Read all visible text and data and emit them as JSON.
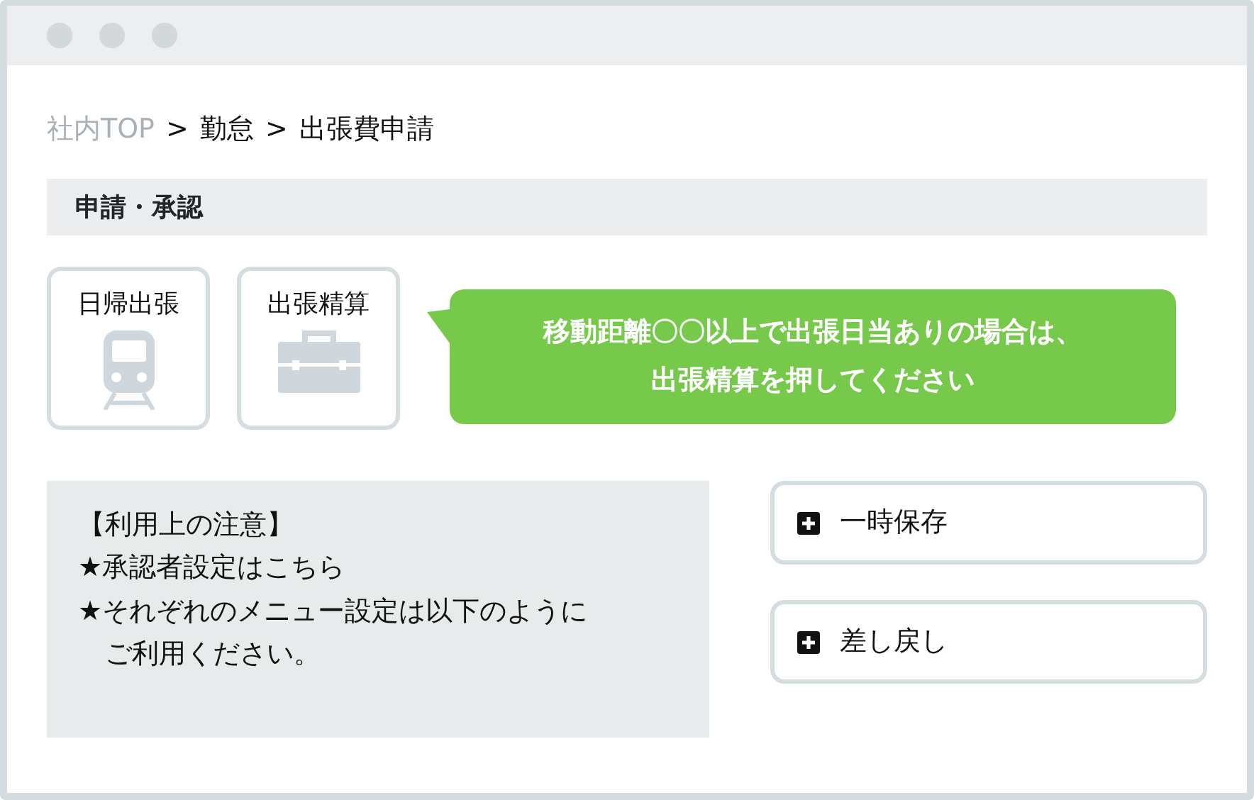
{
  "breadcrumb": [
    {
      "kind": "muted",
      "label": "社内TOP"
    },
    {
      "kind": "separator",
      "label": ">"
    },
    {
      "kind": "current",
      "label": "勤怠"
    },
    {
      "kind": "separator",
      "label": ">"
    },
    {
      "kind": "current",
      "label": "出張費申請"
    }
  ],
  "section": {
    "title": "申請・承認"
  },
  "tiles": [
    {
      "label": "日帰出張",
      "kind": "train"
    },
    {
      "label": "出張精算",
      "kind": "briefcase"
    }
  ],
  "hint": {
    "text": "移動距離〇〇以上で出張日当ありの場合は、出張精算を押してください"
  },
  "notes": {
    "title": "【利用上の注意】",
    "lines": [
      "★承認者設定はこちら",
      "★それぞれのメニュー設定は以下のようにご利用ください。"
    ]
  },
  "buttons": [
    {
      "label": "一時保存"
    },
    {
      "label": "差し戻し"
    }
  ]
}
